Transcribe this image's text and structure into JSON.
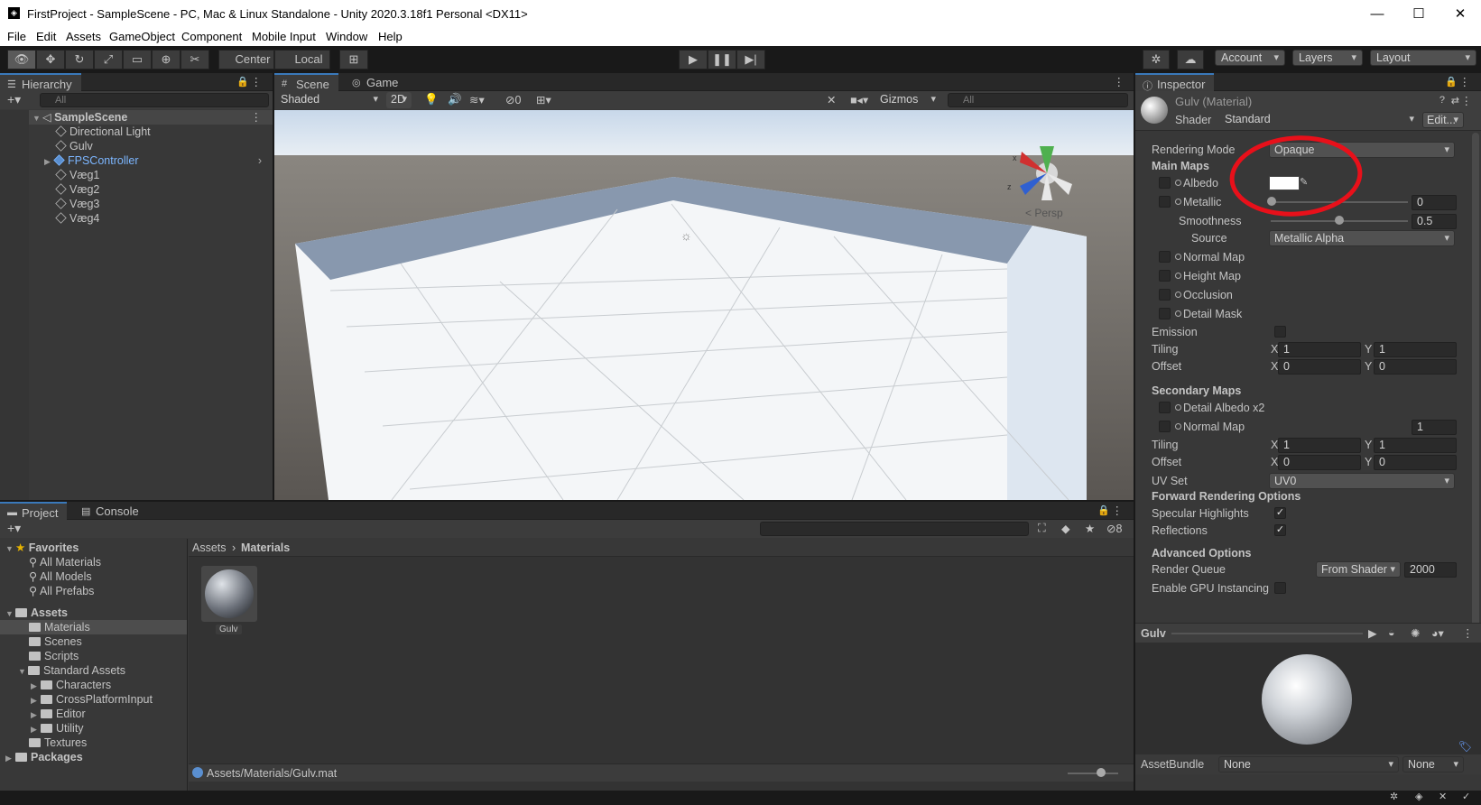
{
  "window": {
    "title": "FirstProject - SampleScene - PC, Mac & Linux Standalone - Unity 2020.3.18f1 Personal <DX11>"
  },
  "menu": [
    "File",
    "Edit",
    "Assets",
    "GameObject",
    "Component",
    "Mobile Input",
    "Window",
    "Help"
  ],
  "toolbar": {
    "pivot": "Center",
    "space": "Local",
    "account": "Account",
    "layers": "Layers",
    "layout": "Layout"
  },
  "hierarchy": {
    "tab": "Hierarchy",
    "search_placeholder": "All",
    "scene": "SampleScene",
    "items": [
      "Directional Light",
      "Gulv",
      "FPSController",
      "Væg1",
      "Væg2",
      "Væg3",
      "Væg4"
    ]
  },
  "scene": {
    "tabs": [
      "Scene",
      "Game"
    ],
    "shading": "Shaded",
    "mode_2d": "2D",
    "hidden_count": "0",
    "gizmos": "Gizmos",
    "search_placeholder": "All",
    "persp": "< Persp"
  },
  "inspector": {
    "tab": "Inspector",
    "material": "Gulv (Material)",
    "shader_label": "Shader",
    "shader": "Standard",
    "edit": "Edit...",
    "rendering_mode_label": "Rendering Mode",
    "rendering_mode": "Opaque",
    "main_maps": "Main Maps",
    "albedo": "Albedo",
    "metallic": "Metallic",
    "metallic_value": "0",
    "smoothness": "Smoothness",
    "smoothness_value": "0.5",
    "source_label": "Source",
    "source": "Metallic Alpha",
    "normal_map": "Normal Map",
    "height_map": "Height Map",
    "occlusion": "Occlusion",
    "detail_mask": "Detail Mask",
    "emission": "Emission",
    "tiling": "Tiling",
    "offset": "Offset",
    "x": "X",
    "y": "Y",
    "tiling_x": "1",
    "tiling_y": "1",
    "offset_x": "0",
    "offset_y": "0",
    "secondary_maps": "Secondary Maps",
    "detail_albedo": "Detail Albedo x2",
    "normal_map2": "Normal Map",
    "normal_map2_value": "1",
    "tiling2_x": "1",
    "tiling2_y": "1",
    "offset2_x": "0",
    "offset2_y": "0",
    "uv_set_label": "UV Set",
    "uv_set": "UV0",
    "forward_rendering": "Forward Rendering Options",
    "specular_highlights": "Specular Highlights",
    "reflections": "Reflections",
    "advanced": "Advanced Options",
    "render_queue_label": "Render Queue",
    "render_queue": "From Shader",
    "render_queue_value": "2000",
    "gpu_instancing": "Enable GPU Instancing",
    "preview_name": "Gulv",
    "assetbundle_label": "AssetBundle",
    "assetbundle": "None",
    "assetbundle_variant": "None"
  },
  "project": {
    "tabs": [
      "Project",
      "Console"
    ],
    "favorites": "Favorites",
    "fav_items": [
      "All Materials",
      "All Models",
      "All Prefabs"
    ],
    "assets": "Assets",
    "asset_folders": [
      "Materials",
      "Scenes",
      "Scripts",
      "Standard Assets"
    ],
    "standard_children": [
      "Characters",
      "CrossPlatformInput",
      "Editor",
      "Utility"
    ],
    "textures": "Textures",
    "packages": "Packages",
    "breadcrumb_root": "Assets",
    "breadcrumb_current": "Materials",
    "hidden_count": "8",
    "asset_name": "Gulv",
    "status_path": "Assets/Materials/Gulv.mat"
  },
  "colors": {
    "accent": "#3a79bb",
    "annotation": "#e8101a",
    "link": "#7cb6ff"
  }
}
